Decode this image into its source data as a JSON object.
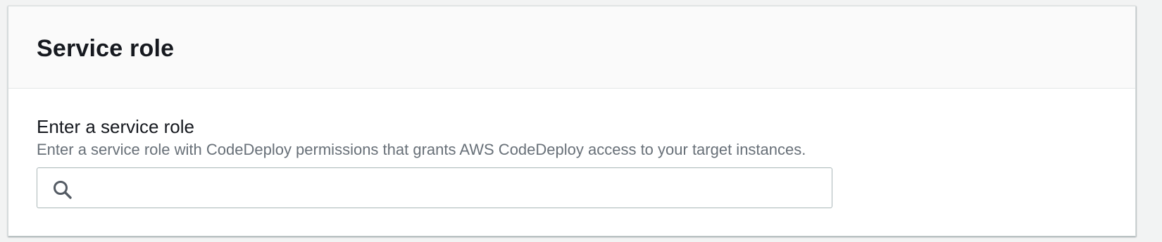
{
  "panel": {
    "title": "Service role",
    "field": {
      "label": "Enter a service role",
      "description": "Enter a service role with CodeDeploy permissions that grants AWS CodeDeploy access to your target instances.",
      "value": "",
      "placeholder": "",
      "icon": "search-icon"
    }
  },
  "colors": {
    "text_primary": "#16191f",
    "text_secondary": "#687078",
    "border": "#aab7b8",
    "header_bg": "#fafafa"
  }
}
